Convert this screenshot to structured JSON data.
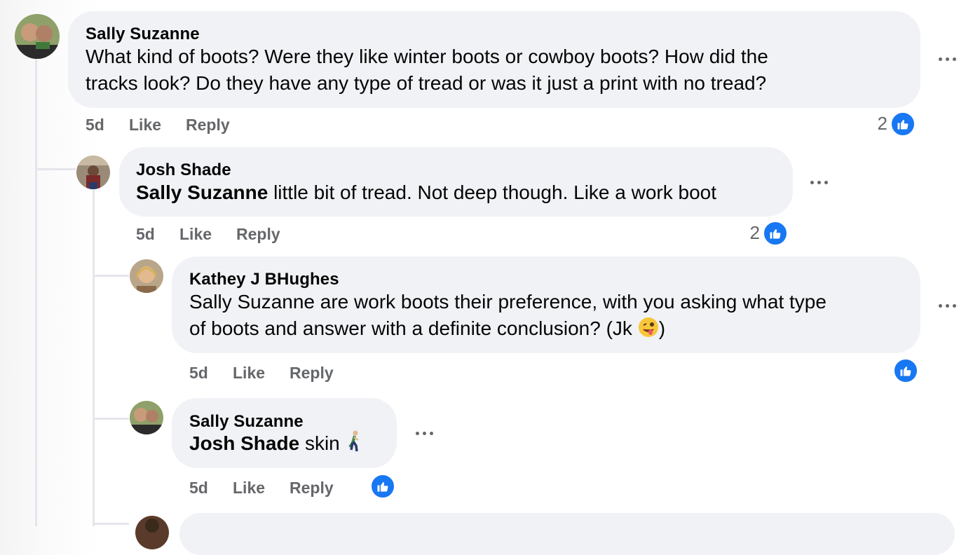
{
  "comments": [
    {
      "author": "Sally Suzanne",
      "text_line1": "What kind of boots? Were they like winter boots or cowboy boots? How did the",
      "text_line2": "tracks look? Do they have any type of tread or was it just a print with no tread?",
      "time": "5d",
      "like_label": "Like",
      "reply_label": "Reply",
      "reaction_count": "2"
    },
    {
      "author": "Josh Shade",
      "tag": "Sally Suzanne",
      "text": " little bit of tread. Not deep though. Like a work boot",
      "time": "5d",
      "like_label": "Like",
      "reply_label": "Reply",
      "reaction_count": "2"
    },
    {
      "author": "Kathey J BHughes",
      "text_line1": "Sally Suzanne are work boots their preference, with you asking what type",
      "text_line2": "of boots and answer with a definite conclusion? (Jk ",
      "text_line2_end": ")",
      "time": "5d",
      "like_label": "Like",
      "reply_label": "Reply",
      "emoji": "winking-face-with-tongue"
    },
    {
      "author": "Sally Suzanne",
      "tag": "Josh Shade",
      "text": " skin ",
      "time": "5d",
      "like_label": "Like",
      "reply_label": "Reply",
      "emoji": "person-walking"
    }
  ],
  "colors": {
    "bubble": "#f0f2f5",
    "meta_text": "#65676b",
    "like_blue": "#1877f2",
    "thread_line": "#e4e6eb"
  }
}
